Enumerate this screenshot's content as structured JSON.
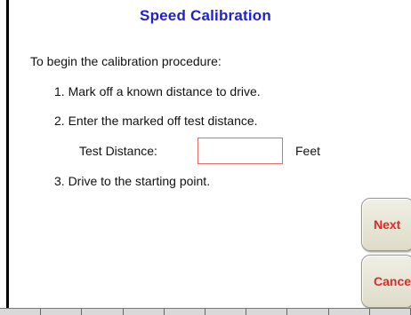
{
  "title": "Speed Calibration",
  "intro": "To begin the calibration procedure:",
  "steps": {
    "step1": "1. Mark off a known distance to drive.",
    "step2": "2. Enter the marked off test distance.",
    "step3": "3. Drive to the starting point."
  },
  "test_distance": {
    "label": "Test Distance:",
    "value": "",
    "unit": "Feet"
  },
  "buttons": {
    "next": "Next",
    "cancel": "Cance"
  },
  "colors": {
    "title": "#1f1fd4",
    "button_text": "#e0282a",
    "input_border": "#e56a6a"
  }
}
